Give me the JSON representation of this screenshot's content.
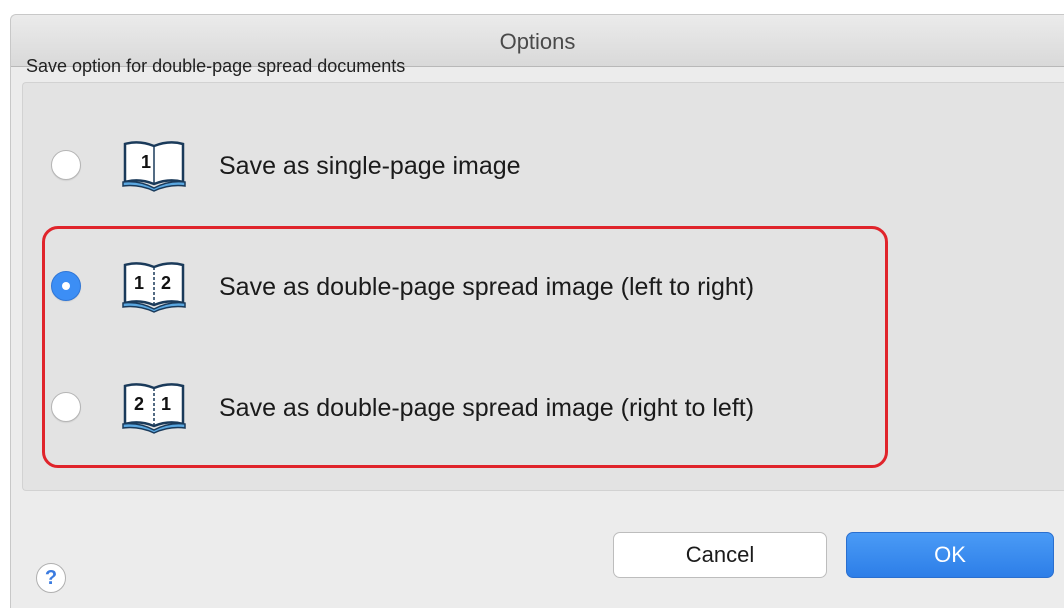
{
  "window": {
    "title": "Options"
  },
  "group": {
    "label": "Save option for double-page spread documents"
  },
  "options": [
    {
      "label": "Save as single-page image",
      "icon": "book-single-page-icon",
      "icon_text": [
        "1"
      ],
      "checked": false
    },
    {
      "label": "Save as double-page spread image (left to right)",
      "icon": "book-left-to-right-icon",
      "icon_text": [
        "1",
        "2"
      ],
      "checked": true
    },
    {
      "label": "Save as double-page spread image (right to left)",
      "icon": "book-right-to-left-icon",
      "icon_text": [
        "2",
        "1"
      ],
      "checked": false
    }
  ],
  "buttons": {
    "help": "?",
    "cancel": "Cancel",
    "ok": "OK"
  },
  "colors": {
    "accent": "#3c8ef5",
    "highlight": "#e0242b"
  }
}
